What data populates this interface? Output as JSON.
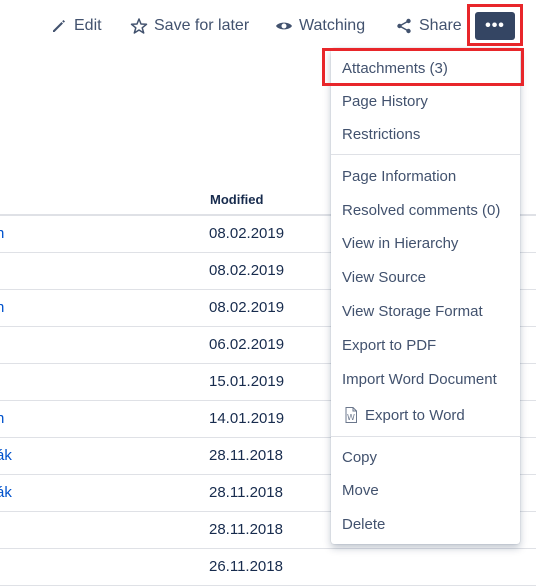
{
  "toolbar": {
    "edit_label": "Edit",
    "edit_icon": "pencil-icon",
    "save_label": "Save for later",
    "save_icon": "star-icon",
    "watch_label": "Watching",
    "watch_icon": "eye-icon",
    "share_label": "Share",
    "share_icon": "share-icon",
    "more_label": "•••",
    "more_icon": "more-dots-icon"
  },
  "table": {
    "modified_header": "Modified",
    "rows": [
      {
        "name": "n",
        "modified": "08.02.2019"
      },
      {
        "name": "",
        "modified": "08.02.2019"
      },
      {
        "name": "n",
        "modified": "08.02.2019"
      },
      {
        "name": "",
        "modified": "06.02.2019"
      },
      {
        "name": "",
        "modified": "15.01.2019"
      },
      {
        "name": "n",
        "modified": "14.01.2019"
      },
      {
        "name": "ák",
        "modified": "28.11.2018"
      },
      {
        "name": "ák",
        "modified": "28.11.2018"
      },
      {
        "name": "",
        "modified": "28.11.2018"
      },
      {
        "name": "",
        "modified": "26.11.2018"
      }
    ]
  },
  "menu": {
    "items": [
      {
        "label": "Attachments (3)"
      },
      {
        "label": "Page History"
      },
      {
        "label": "Restrictions"
      },
      {
        "label": "Page Information"
      },
      {
        "label": "Resolved comments (0)"
      },
      {
        "label": "View in Hierarchy"
      },
      {
        "label": "View Source"
      },
      {
        "label": "View Storage Format"
      },
      {
        "label": "Export to PDF"
      },
      {
        "label": "Import Word Document"
      },
      {
        "label": "Export to Word",
        "icon": "word-document-icon"
      },
      {
        "label": "Copy"
      },
      {
        "label": "Move"
      },
      {
        "label": "Delete"
      }
    ]
  },
  "colors": {
    "highlight": "#e8262a",
    "more_button_bg": "#344563",
    "link": "#0052cc",
    "text": "#42526e"
  }
}
